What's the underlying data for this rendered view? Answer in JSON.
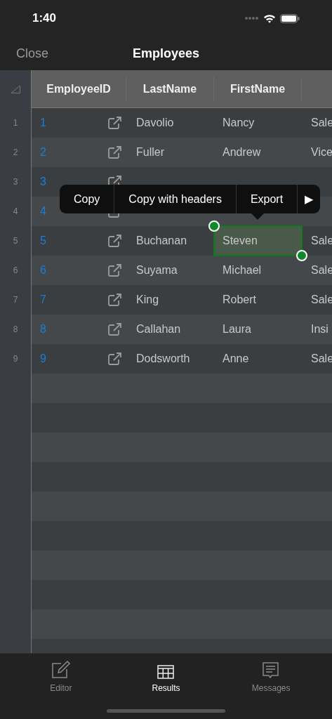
{
  "status_bar": {
    "time": "1:40"
  },
  "nav": {
    "left_button": "Close",
    "title": "Employees"
  },
  "table": {
    "columns": [
      "EmployeeID",
      "LastName",
      "FirstName"
    ],
    "rows": [
      {
        "number": "1",
        "id": "1",
        "last_name": "Davolio",
        "first_name": "Nancy",
        "column_4": "Sale",
        "selected": false
      },
      {
        "number": "2",
        "id": "2",
        "last_name": "Fuller",
        "first_name": "Andrew",
        "column_4": "Vice",
        "selected": false
      },
      {
        "number": "3",
        "id": "3",
        "selected": false
      },
      {
        "number": "4",
        "id": "4",
        "selected": false
      },
      {
        "number": "5",
        "id": "5",
        "last_name": "Buchanan",
        "first_name": "Steven",
        "column_4": "Sale",
        "selected": true
      },
      {
        "number": "6",
        "id": "6",
        "last_name": "Suyama",
        "first_name": "Michael",
        "column_4": "Sale",
        "selected": false
      },
      {
        "number": "7",
        "id": "7",
        "last_name": "King",
        "first_name": "Robert",
        "column_4": "Sale",
        "selected": false
      },
      {
        "number": "8",
        "id": "8",
        "last_name": "Callahan",
        "first_name": "Laura",
        "column_4": "Insi",
        "selected": false
      },
      {
        "number": "9",
        "id": "9",
        "last_name": "Dodsworth",
        "first_name": "Anne",
        "column_4": "Sale",
        "selected": false
      }
    ]
  },
  "context_menu": {
    "items": [
      "Copy",
      "Copy with headers",
      "Export",
      "▶"
    ]
  },
  "tab_bar": {
    "tabs": [
      {
        "kind": "editor",
        "label": "Editor",
        "selected": false
      },
      {
        "kind": "results",
        "label": "Results",
        "selected": true
      },
      {
        "kind": "messages",
        "label": "Messages",
        "selected": false
      }
    ]
  }
}
